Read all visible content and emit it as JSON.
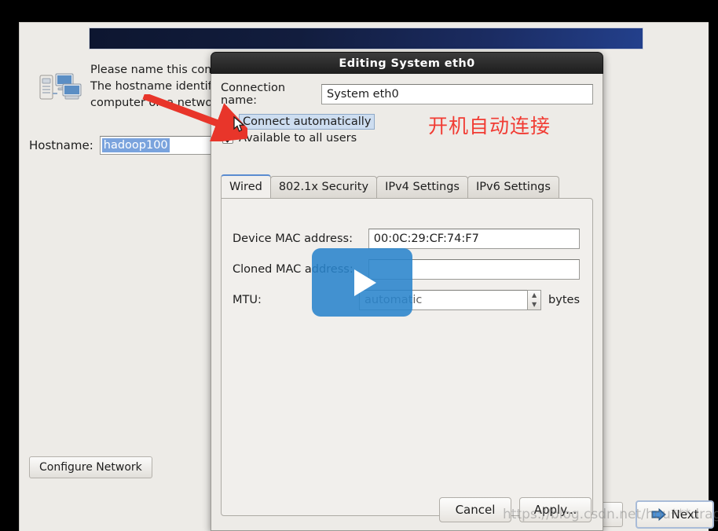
{
  "installer": {
    "intro_text": "Please name this computer. The hostname identifies the computer on a network.",
    "hostname_label": "Hostname:",
    "hostname_value": "hadoop100",
    "configure_network_label": "Configure Network",
    "next_label": "Next",
    "icons": {
      "network_computers": "network-computers-icon",
      "next_arrow": "blue-arrow-right-icon"
    }
  },
  "dialog": {
    "title": "Editing System eth0",
    "connection_name_label": "Connection name:",
    "connection_name_value": "System eth0",
    "connect_automatically_label": "Connect automatically",
    "connect_automatically_checked": true,
    "available_all_users_label": "Available to all users",
    "available_all_users_checked": true,
    "tabs": [
      {
        "label": "Wired",
        "active": true
      },
      {
        "label": "802.1x Security",
        "active": false
      },
      {
        "label": "IPv4 Settings",
        "active": false
      },
      {
        "label": "IPv6 Settings",
        "active": false
      }
    ],
    "wired": {
      "device_mac_label": "Device MAC address:",
      "device_mac_value": "00:0C:29:CF:74:F7",
      "cloned_mac_label": "Cloned MAC address:",
      "cloned_mac_value": "",
      "mtu_label": "MTU:",
      "mtu_value": "automatic",
      "mtu_units": "bytes",
      "spin_up": "▲",
      "spin_down": "▼"
    },
    "cancel_label": "Cancel",
    "apply_label": "Apply..."
  },
  "annotations": {
    "chinese_note": "开机自动连接",
    "arrow_color": "#e8352a",
    "watermark": "https://blog.csdn.net/hou***dragonet",
    "play_button": "play-button-overlay"
  }
}
